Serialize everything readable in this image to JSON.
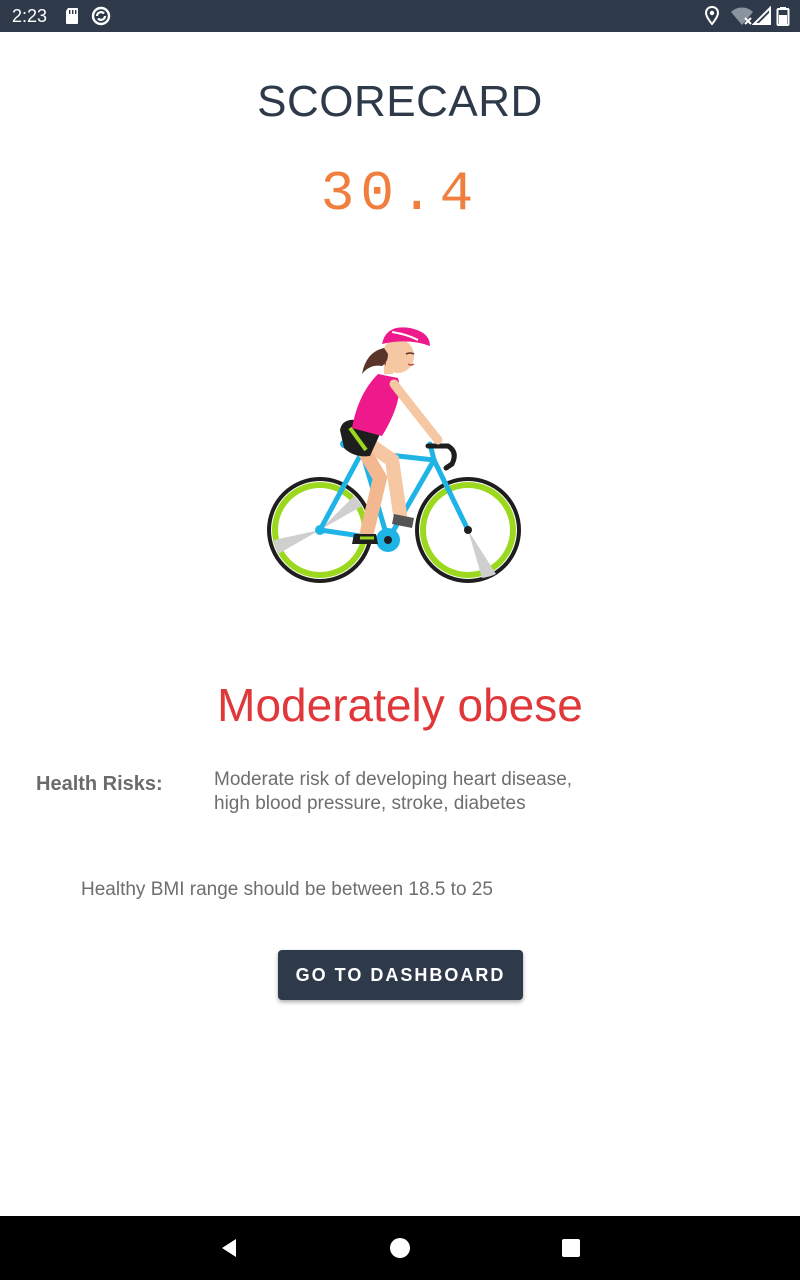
{
  "status_bar": {
    "time": "2:23",
    "icons": [
      "sd-card-icon",
      "sync-icon",
      "location-icon",
      "wifi-icon",
      "signal-icon"
    ]
  },
  "scorecard": {
    "title": "SCORECARD",
    "bmi_value": "30.4",
    "category": "Moderately obese",
    "health_risks_label": "Health Risks:",
    "health_risks_text": "Moderate risk of developing heart disease, high blood pressure, stroke, diabetes",
    "healthy_range_text": "Healthy BMI range should be between 18.5 to 25",
    "button_label": "GO TO DASHBOARD"
  },
  "colors": {
    "primary_dark": "#2e3a4a",
    "score": "#f07f3f",
    "category": "#e0383a",
    "body_text": "#6e6e6e"
  },
  "nav_bar": {
    "icons": [
      "back-icon",
      "home-icon",
      "recents-icon"
    ]
  }
}
